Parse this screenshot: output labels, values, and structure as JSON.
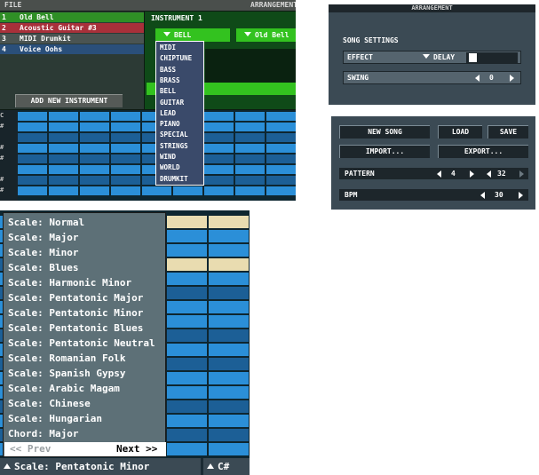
{
  "instrument_editor": {
    "menu": {
      "file": "FILE",
      "arrangement": "ARRANGEMENT"
    },
    "instruments": [
      {
        "num": "1",
        "name": "Old Bell",
        "color": "#2f8f26"
      },
      {
        "num": "2",
        "name": "Acoustic Guitar #3",
        "color": "#a8303a"
      },
      {
        "num": "3",
        "name": "MIDI Drumkit",
        "color": "#4a5452"
      },
      {
        "num": "4",
        "name": "Voice Oohs",
        "color": "#2a4f7a"
      }
    ],
    "add_button": "ADD NEW INSTRUMENT",
    "panel_title": "INSTRUMENT 1",
    "category_select": "BELL",
    "preset_select": "Old Bell",
    "categories": [
      "MIDI",
      "CHIPTUNE",
      "BASS",
      "BRASS",
      "BELL",
      "GUITAR",
      "LEAD",
      "PIANO",
      "SPECIAL",
      "STRINGS",
      "WIND",
      "WORLD",
      "DRUMKIT"
    ],
    "piano_keys": [
      "C",
      "#",
      "",
      "#",
      "#",
      "",
      "#",
      "#"
    ]
  },
  "arrangement": {
    "title": "ARRANGEMENT",
    "section": "SONG SETTINGS",
    "effect_label": "EFFECT",
    "effect_value": "DELAY",
    "swing_label": "SWING",
    "swing_value": "0"
  },
  "song_controls": {
    "new_song": "NEW SONG",
    "load": "LOAD",
    "save": "SAVE",
    "import": "IMPORT...",
    "export": "EXPORT...",
    "pattern_label": "PATTERN",
    "pattern_value": "4",
    "pattern_length": "32",
    "bpm_label": "BPM",
    "bpm_value": "30"
  },
  "scale_menu": {
    "items": [
      "Scale: Normal",
      "Scale: Major",
      "Scale: Minor",
      "Scale: Blues",
      "Scale: Harmonic Minor",
      "Scale: Pentatonic Major",
      "Scale: Pentatonic Minor",
      "Scale: Pentatonic Blues",
      "Scale: Pentatonic Neutral",
      "Scale: Romanian Folk",
      "Scale: Spanish Gypsy",
      "Scale: Arabic Magam",
      "Scale: Chinese",
      "Scale: Hungarian",
      "Chord: Major"
    ],
    "prev": "<< Prev",
    "next": "Next >>",
    "current_scale": "Scale: Pentatonic Minor",
    "current_key": "C#"
  },
  "colors": {
    "cell_light": "#2b8fd8",
    "cell_dark": "#1c5f96",
    "cell_highlight": "#e9dcb0",
    "green": "#33c21f"
  }
}
